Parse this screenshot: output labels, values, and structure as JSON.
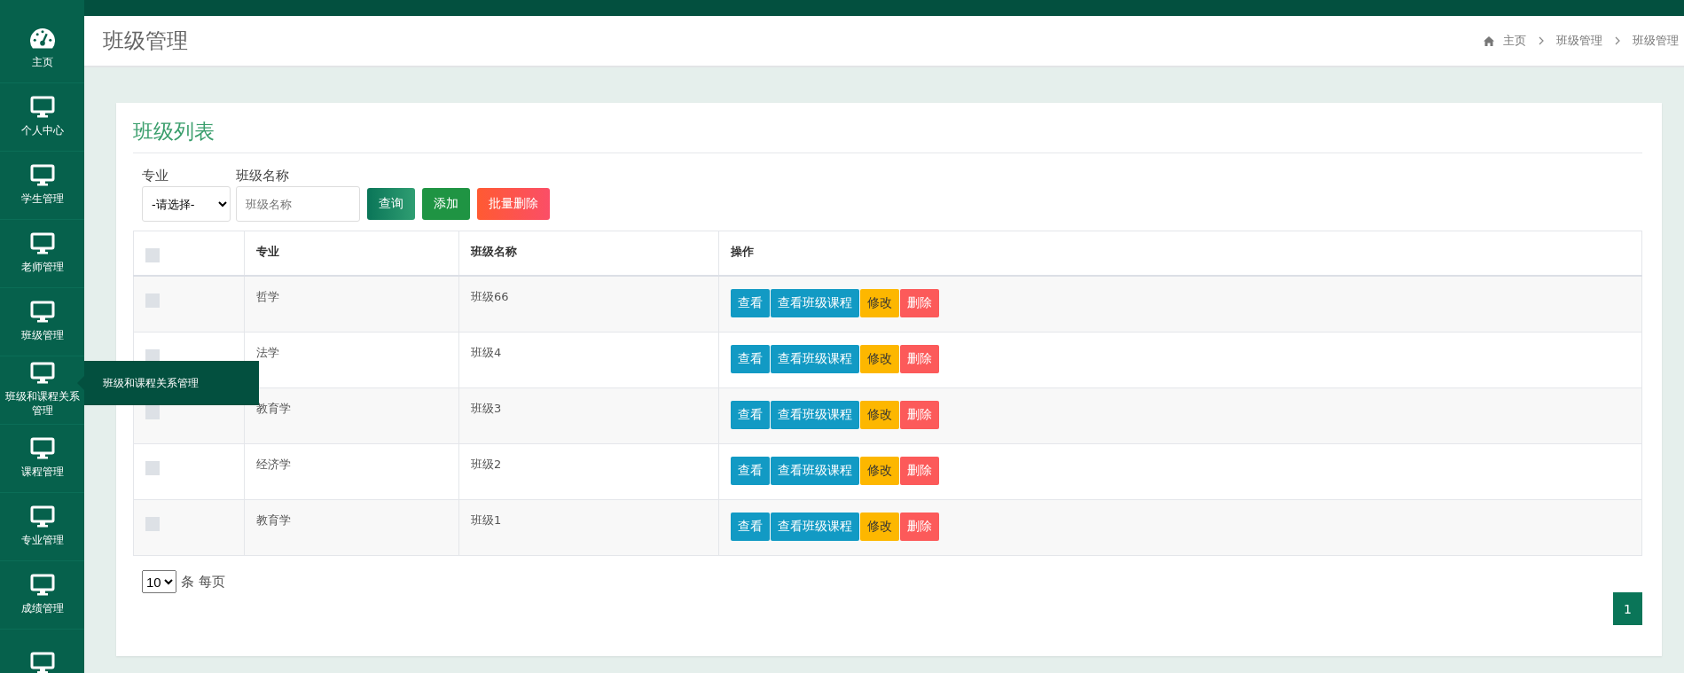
{
  "sidebar": {
    "items": [
      {
        "kind": "home",
        "label": "主页"
      },
      {
        "kind": "module",
        "label": "个人中心"
      },
      {
        "kind": "module",
        "label": "学生管理"
      },
      {
        "kind": "module",
        "label": "老师管理"
      },
      {
        "kind": "module",
        "label": "班级管理"
      },
      {
        "kind": "module",
        "label": "班级和课程关系管理"
      },
      {
        "kind": "module",
        "label": "课程管理"
      },
      {
        "kind": "module",
        "label": "专业管理"
      },
      {
        "kind": "module",
        "label": "成绩管理"
      },
      {
        "kind": "module"
      }
    ]
  },
  "tooltip": {
    "text": "班级和课程关系管理"
  },
  "header": {
    "title": "班级管理",
    "breadcrumb": [
      "主页",
      "班级管理",
      "班级管理"
    ]
  },
  "card": {
    "title": "班级列表",
    "filters": [
      {
        "kind": "select",
        "label": "专业",
        "value": "-请选择-"
      },
      {
        "kind": "input",
        "label": "班级名称",
        "placeholder": "班级名称"
      }
    ],
    "buttons": [
      {
        "kind": "search",
        "label": "查询"
      },
      {
        "kind": "add",
        "label": "添加"
      },
      {
        "kind": "delete",
        "label": "批量删除"
      }
    ],
    "table": {
      "all_checked": false,
      "columns": [
        "专业",
        "班级名称",
        "操作"
      ],
      "rows": [
        {
          "checked": false,
          "major": "哲学",
          "name": "班级66",
          "actions": [
            {
              "kind": "view",
              "label": "查看"
            },
            {
              "kind": "view",
              "label": "查看班级课程"
            },
            {
              "kind": "edit",
              "label": "修改"
            },
            {
              "kind": "delete",
              "label": "删除"
            }
          ]
        },
        {
          "checked": false,
          "major": "法学",
          "name": "班级4",
          "actions": [
            {
              "kind": "view",
              "label": "查看"
            },
            {
              "kind": "view",
              "label": "查看班级课程"
            },
            {
              "kind": "edit",
              "label": "修改"
            },
            {
              "kind": "delete",
              "label": "删除"
            }
          ]
        },
        {
          "checked": false,
          "major": "教育学",
          "name": "班级3",
          "actions": [
            {
              "kind": "view",
              "label": "查看"
            },
            {
              "kind": "view",
              "label": "查看班级课程"
            },
            {
              "kind": "edit",
              "label": "修改"
            },
            {
              "kind": "delete",
              "label": "删除"
            }
          ]
        },
        {
          "checked": false,
          "major": "经济学",
          "name": "班级2",
          "actions": [
            {
              "kind": "view",
              "label": "查看"
            },
            {
              "kind": "view",
              "label": "查看班级课程"
            },
            {
              "kind": "edit",
              "label": "修改"
            },
            {
              "kind": "delete",
              "label": "删除"
            }
          ]
        },
        {
          "checked": false,
          "major": "教育学",
          "name": "班级1",
          "actions": [
            {
              "kind": "view",
              "label": "查看"
            },
            {
              "kind": "view",
              "label": "查看班级课程"
            },
            {
              "kind": "edit",
              "label": "修改"
            },
            {
              "kind": "delete",
              "label": "删除"
            }
          ]
        }
      ]
    },
    "page_size": {
      "value": "10",
      "label": "条 每页"
    },
    "pages": [
      {
        "label": "1",
        "selected": true
      }
    ]
  }
}
